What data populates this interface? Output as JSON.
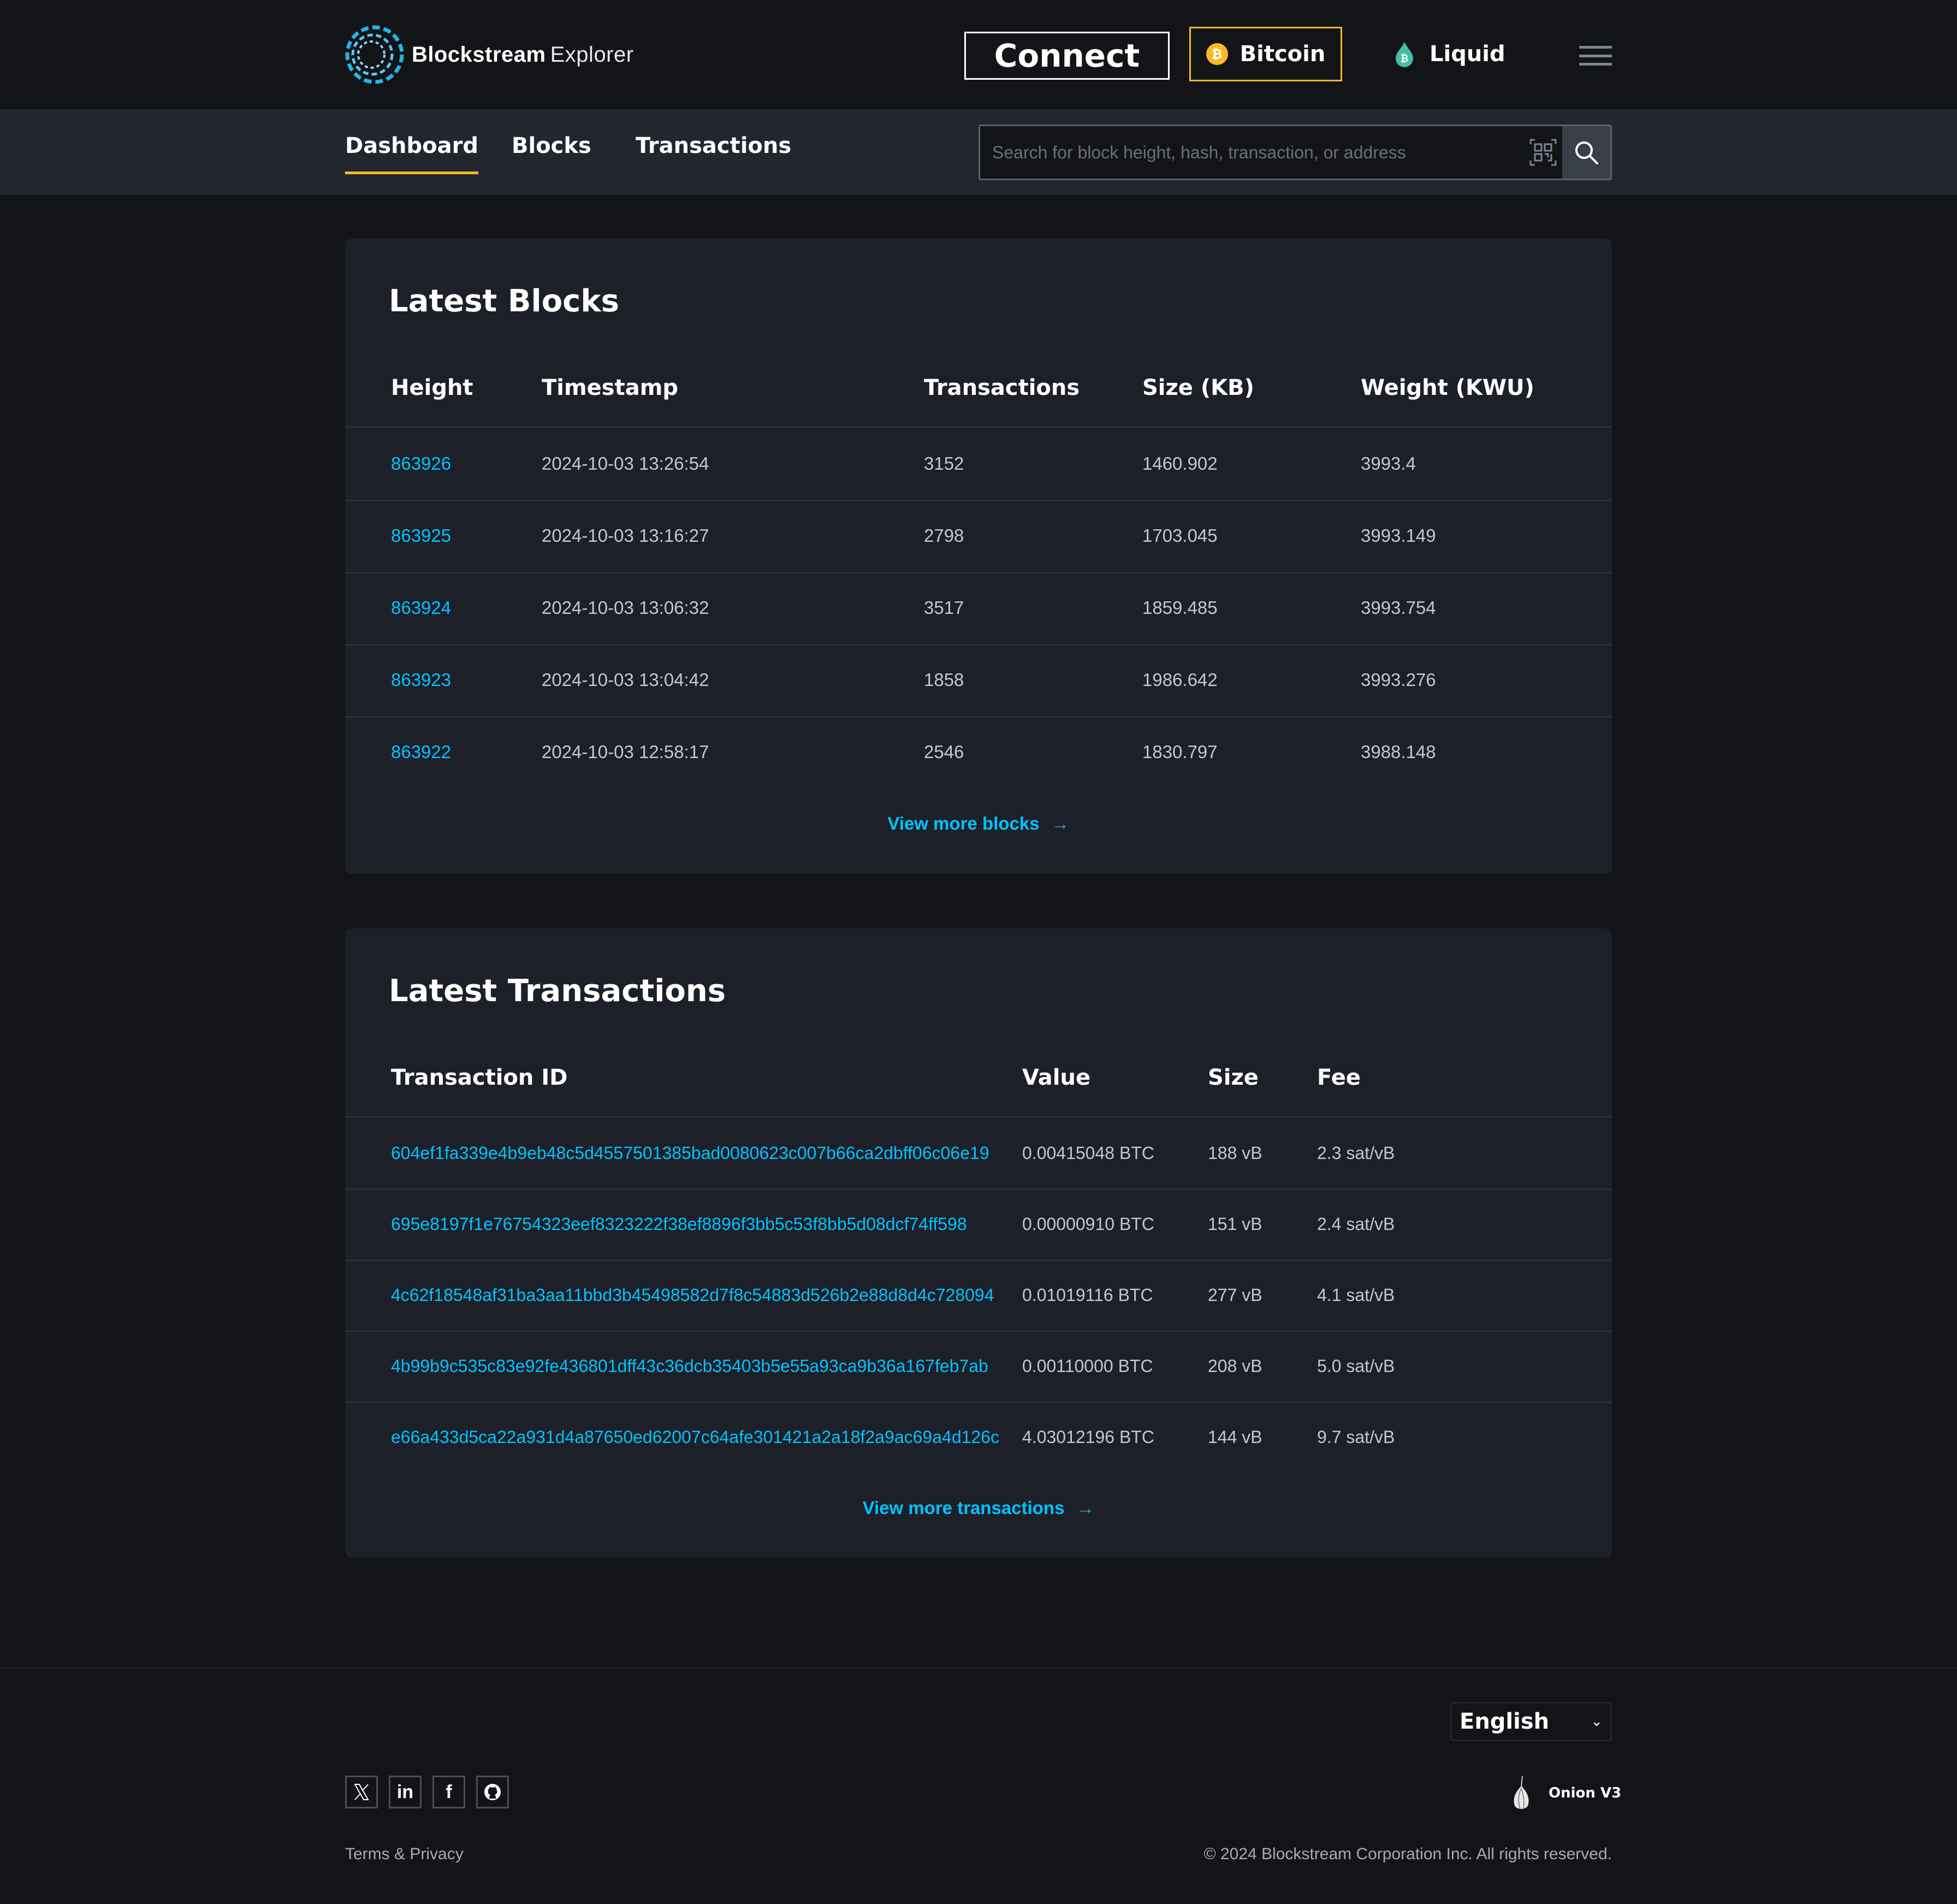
{
  "header": {
    "brand_bold": "Blockstream",
    "brand_light": "Explorer",
    "connect_label": "Connect",
    "networks": [
      {
        "label": "Bitcoin",
        "icon": "bitcoin-coin-icon",
        "active": true
      },
      {
        "label": "Liquid",
        "icon": "liquid-drop-icon",
        "active": false
      }
    ],
    "menu_icon": "hamburger-menu-icon",
    "accent_color": "#f7b928"
  },
  "nav": {
    "tabs": [
      {
        "label": "Dashboard",
        "active": true
      },
      {
        "label": "Blocks",
        "active": false
      },
      {
        "label": "Transactions",
        "active": false
      }
    ],
    "search": {
      "placeholder": "Search for block height, hash, transaction, or address",
      "value": "",
      "qr_icon": "qr-code-icon",
      "button_icon": "search-icon"
    }
  },
  "blocks": {
    "title": "Latest Blocks",
    "columns": [
      "Height",
      "Timestamp",
      "Transactions",
      "Size (KB)",
      "Weight (KWU)"
    ],
    "rows": [
      {
        "height": "863926",
        "timestamp": "2024-10-03 13:26:54",
        "transactions": "3152",
        "size": "1460.902",
        "weight": "3993.4"
      },
      {
        "height": "863925",
        "timestamp": "2024-10-03 13:16:27",
        "transactions": "2798",
        "size": "1703.045",
        "weight": "3993.149"
      },
      {
        "height": "863924",
        "timestamp": "2024-10-03 13:06:32",
        "transactions": "3517",
        "size": "1859.485",
        "weight": "3993.754"
      },
      {
        "height": "863923",
        "timestamp": "2024-10-03 13:04:42",
        "transactions": "1858",
        "size": "1986.642",
        "weight": "3993.276"
      },
      {
        "height": "863922",
        "timestamp": "2024-10-03 12:58:17",
        "transactions": "2546",
        "size": "1830.797",
        "weight": "3988.148"
      }
    ],
    "more_label": "View more blocks",
    "more_arrow": "→"
  },
  "transactions": {
    "title": "Latest Transactions",
    "columns": [
      "Transaction ID",
      "Value",
      "Size",
      "Fee"
    ],
    "rows": [
      {
        "txid": "604ef1fa339e4b9eb48c5d4557501385bad0080623c007b66ca2dbff06c06e19",
        "value": "0.00415048 BTC",
        "size": "188 vB",
        "fee": "2.3 sat/vB"
      },
      {
        "txid": "695e8197f1e76754323eef8323222f38ef8896f3bb5c53f8bb5d08dcf74ff598",
        "value": "0.00000910 BTC",
        "size": "151 vB",
        "fee": "2.4 sat/vB"
      },
      {
        "txid": "4c62f18548af31ba3aa11bbd3b45498582d7f8c54883d526b2e88d8d4c728094",
        "value": "0.01019116 BTC",
        "size": "277 vB",
        "fee": "4.1 sat/vB"
      },
      {
        "txid": "4b99b9c535c83e92fe436801dff43c36dcb35403b5e55a93ca9b36a167feb7ab",
        "value": "0.00110000 BTC",
        "size": "208 vB",
        "fee": "5.0 sat/vB"
      },
      {
        "txid": "e66a433d5ca22a931d4a87650ed62007c64afe301421a2a18f2a9ac69a4d126c",
        "value": "4.03012196 BTC",
        "size": "144 vB",
        "fee": "9.7 sat/vB"
      }
    ],
    "more_label": "View more transactions",
    "more_arrow": "→"
  },
  "footer": {
    "language": "English",
    "socials": [
      "x-icon",
      "linkedin-icon",
      "facebook-icon",
      "github-icon"
    ],
    "onion_label": "Onion V3",
    "terms_label": "Terms & Privacy",
    "copyright": "© 2024 Blockstream Corporation Inc. All rights reserved."
  },
  "colors": {
    "link": "#00c3ff",
    "bitcoin": "#f7b928",
    "liquid": "#46bea5"
  }
}
